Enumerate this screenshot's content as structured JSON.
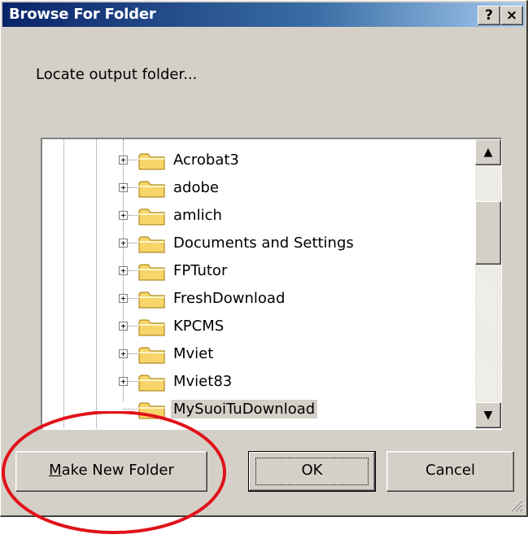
{
  "window": {
    "title": "Browse For Folder",
    "help_glyph": "?",
    "close_glyph": "×"
  },
  "prompt": "Locate output folder...",
  "tree": {
    "items": [
      {
        "label": "Acrobat3",
        "expander": "+",
        "selected": false
      },
      {
        "label": "adobe",
        "expander": "+",
        "selected": false
      },
      {
        "label": "amlich",
        "expander": "+",
        "selected": false
      },
      {
        "label": "Documents and Settings",
        "expander": "+",
        "selected": false
      },
      {
        "label": "FPTutor",
        "expander": "+",
        "selected": false
      },
      {
        "label": "FreshDownload",
        "expander": "+",
        "selected": false
      },
      {
        "label": "KPCMS",
        "expander": "+",
        "selected": false
      },
      {
        "label": "Mviet",
        "expander": "+",
        "selected": false
      },
      {
        "label": "Mviet83",
        "expander": "+",
        "selected": false
      },
      {
        "label": "MySuoiTuDownload",
        "expander": "",
        "selected": true
      }
    ],
    "scroll_up_glyph": "▲",
    "scroll_down_glyph": "▼"
  },
  "buttons": {
    "make_new_folder_mnemonic": "M",
    "make_new_folder_rest": "ake New Folder",
    "ok": "OK",
    "cancel": "Cancel"
  },
  "colors": {
    "dialog_face": "#d4d0c8",
    "title_start": "#0a246a",
    "title_end": "#a6caf0",
    "folder_fill": "#f7d56b",
    "annotation": "#e0121a"
  },
  "icons": {
    "folder": "folder-icon",
    "expander": "plus-box-icon",
    "annotation": "red-ellipse-highlight"
  }
}
